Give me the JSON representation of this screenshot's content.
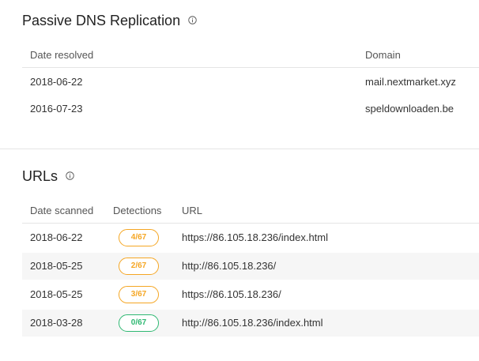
{
  "dns": {
    "title": "Passive DNS Replication",
    "columns": {
      "date": "Date resolved",
      "domain": "Domain"
    },
    "rows": [
      {
        "date": "2018-06-22",
        "domain": "mail.nextmarket.xyz"
      },
      {
        "date": "2016-07-23",
        "domain": "speldownloaden.be"
      }
    ]
  },
  "urls": {
    "title": "URLs",
    "columns": {
      "date": "Date scanned",
      "detections": "Detections",
      "url": "URL"
    },
    "rows": [
      {
        "date": "2018-06-22",
        "detections": "4/67",
        "status": "orange",
        "url": "https://86.105.18.236/index.html"
      },
      {
        "date": "2018-05-25",
        "detections": "2/67",
        "status": "orange",
        "url": "http://86.105.18.236/"
      },
      {
        "date": "2018-05-25",
        "detections": "3/67",
        "status": "orange",
        "url": "https://86.105.18.236/"
      },
      {
        "date": "2018-03-28",
        "detections": "0/67",
        "status": "green",
        "url": "http://86.105.18.236/index.html"
      }
    ]
  },
  "colors": {
    "warning": "#f5a623",
    "clean": "#2eb872"
  },
  "icons": {
    "section_info": "info-icon"
  }
}
